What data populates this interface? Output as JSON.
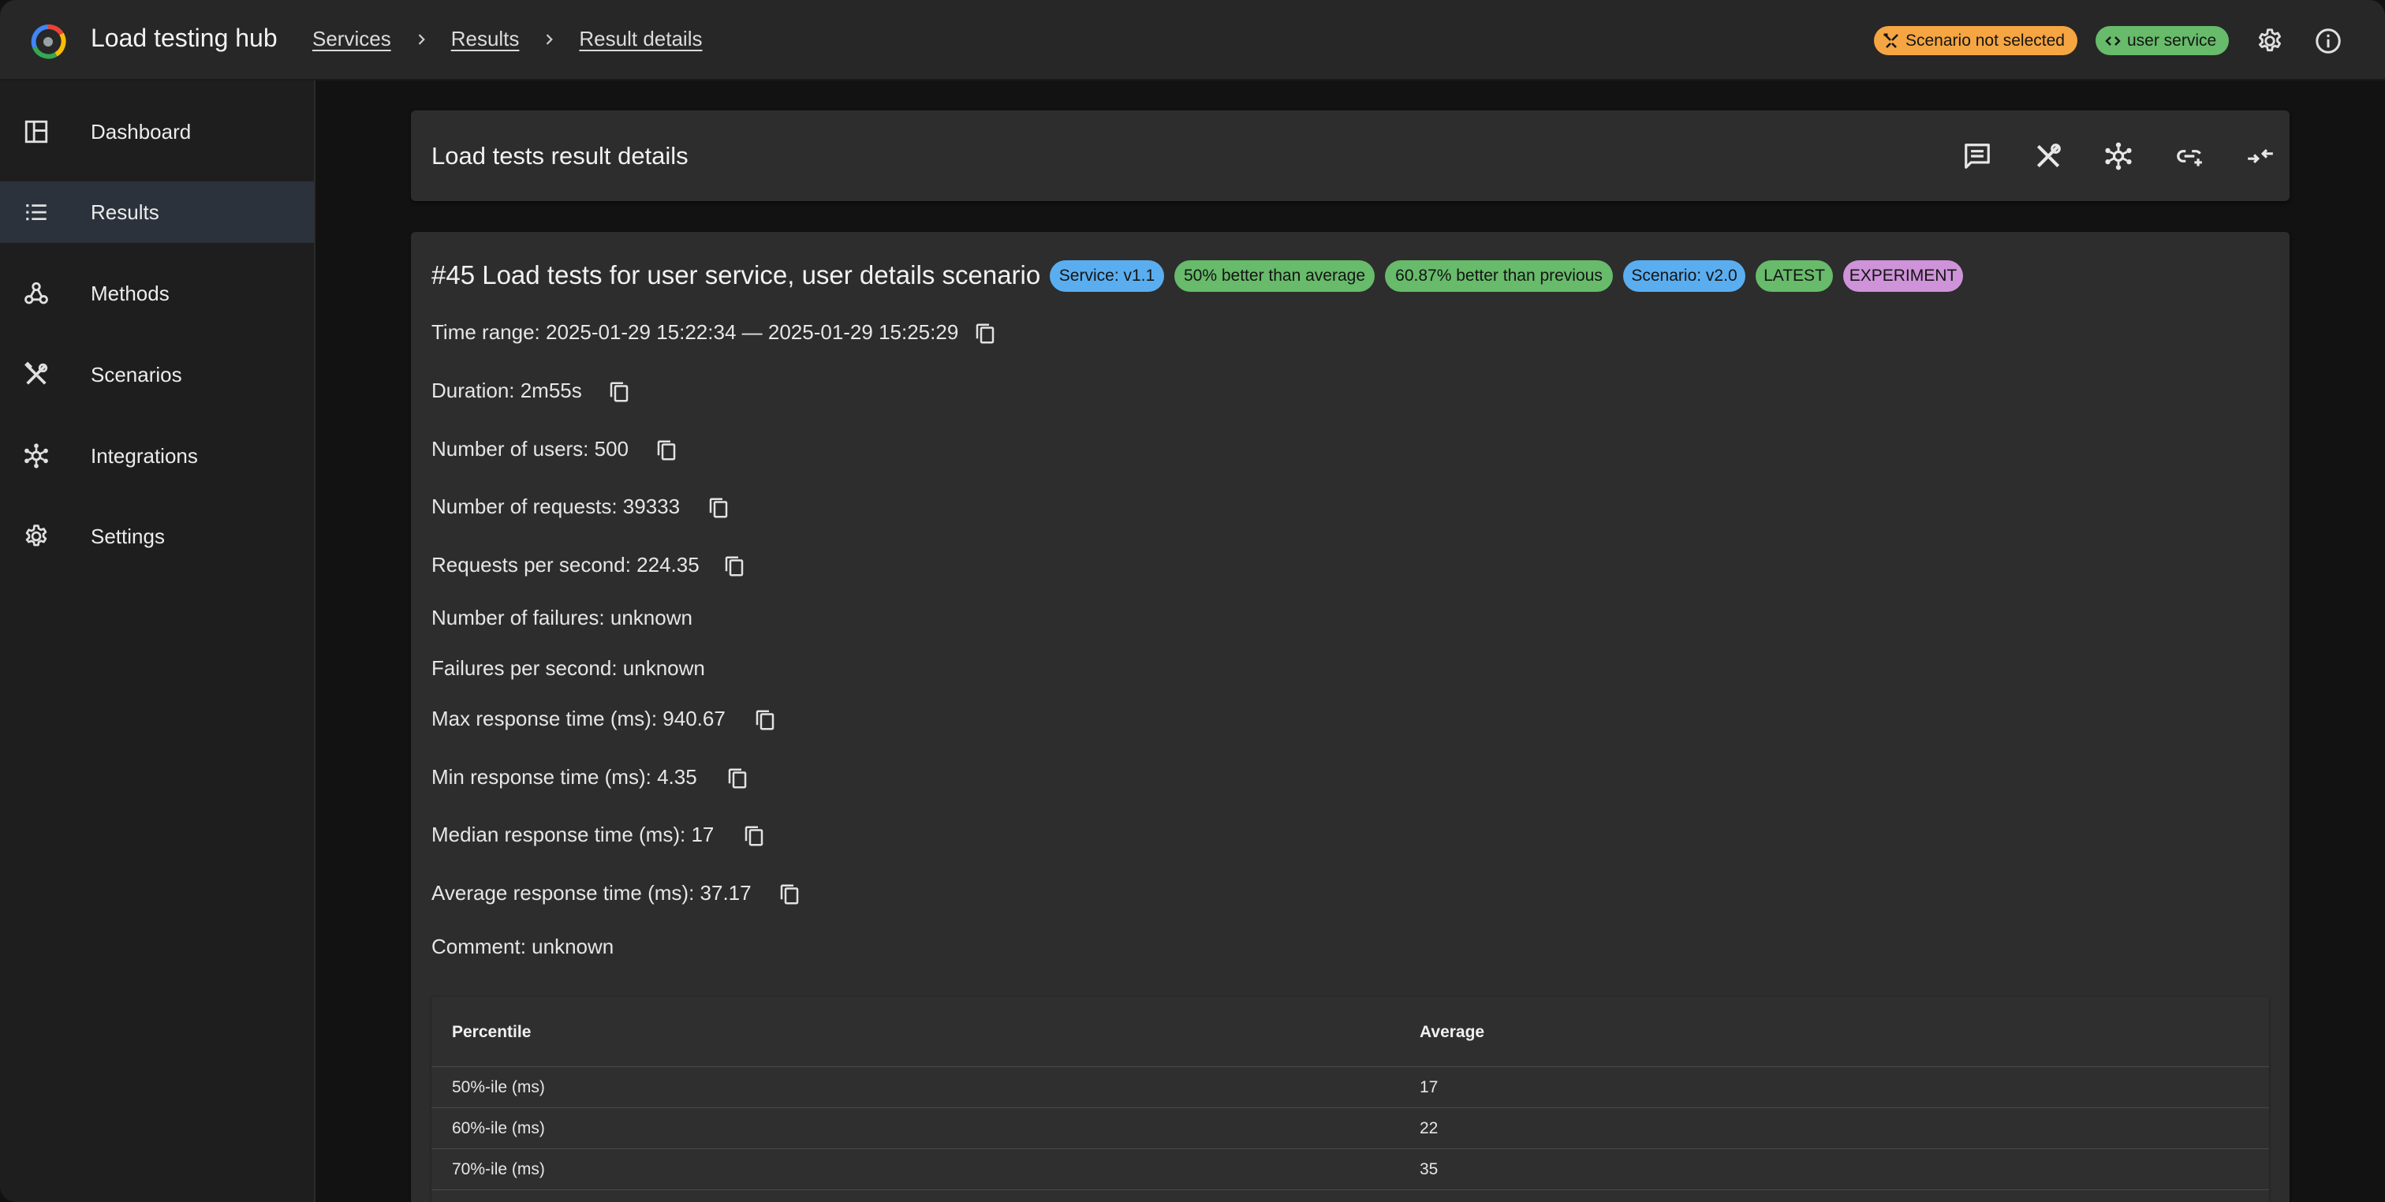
{
  "app": {
    "title": "Load testing hub"
  },
  "breadcrumbs": [
    "Services",
    "Results",
    "Result details"
  ],
  "status_chips": {
    "scenario": "Scenario not selected",
    "service": "user service"
  },
  "sidebar": {
    "items": [
      {
        "label": "Dashboard",
        "icon": "dashboard-icon"
      },
      {
        "label": "Results",
        "icon": "list-icon",
        "active": true
      },
      {
        "label": "Methods",
        "icon": "webhook-icon"
      },
      {
        "label": "Scenarios",
        "icon": "tools-icon"
      },
      {
        "label": "Integrations",
        "icon": "hub-icon"
      },
      {
        "label": "Settings",
        "icon": "gear-icon"
      }
    ]
  },
  "header": {
    "title": "Load tests result details"
  },
  "result": {
    "title": "#45 Load tests for user service, user details scenario",
    "badges": [
      "Service: v1.1",
      "50% better than average",
      "60.87% better than previous",
      "Scenario: v2.0",
      "LATEST",
      "EXPERIMENT"
    ],
    "fields": {
      "time_range": "Time range: 2025-01-29 15:22:34 — 2025-01-29 15:25:29",
      "duration": "Duration: 2m55s",
      "users": "Number of users: 500",
      "requests": "Number of requests: 39333",
      "rps": "Requests per second: 224.35",
      "failures": "Number of failures: unknown",
      "failures_per_second": "Failures per second: unknown",
      "max_rt": "Max response time (ms): 940.67",
      "min_rt": "Min response time (ms): 4.35",
      "median_rt": "Median response time (ms): 17",
      "avg_rt": "Average response time (ms): 37.17",
      "comment": "Comment: unknown"
    }
  },
  "table": {
    "headers": [
      "Percentile",
      "Average"
    ],
    "rows": [
      [
        "50%-ile (ms)",
        "17"
      ],
      [
        "60%-ile (ms)",
        "22"
      ],
      [
        "70%-ile (ms)",
        "35"
      ]
    ]
  },
  "colors": {
    "accent_orange": "#f5a542",
    "accent_green": "#67bb6a",
    "accent_blue": "#5aaef0",
    "accent_purple": "#ce93d8"
  }
}
